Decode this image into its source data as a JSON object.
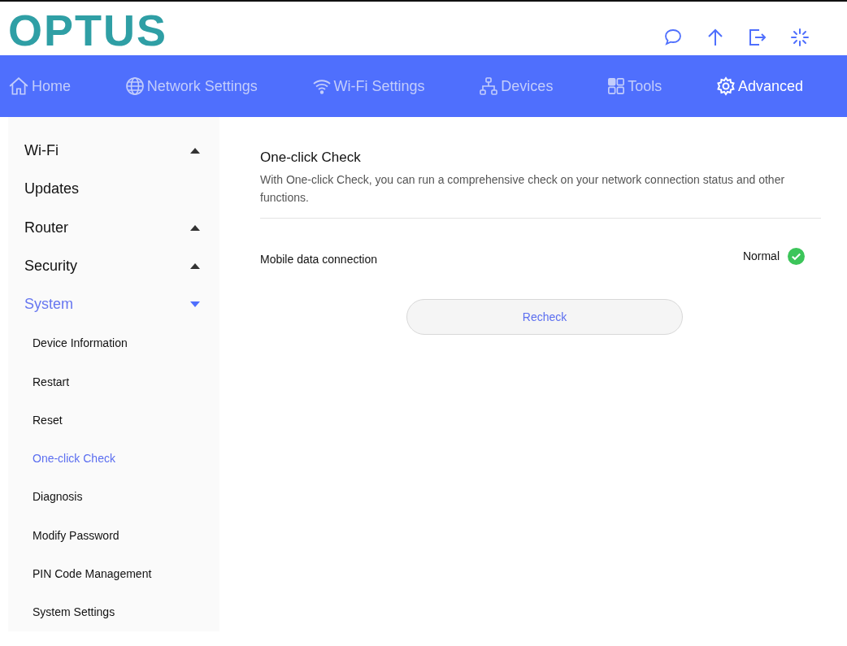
{
  "logo": "OPTUS",
  "nav": [
    {
      "label": "Home",
      "selected": false
    },
    {
      "label": "Network Settings",
      "selected": false
    },
    {
      "label": "Wi-Fi Settings",
      "selected": false
    },
    {
      "label": "Devices",
      "selected": false
    },
    {
      "label": "Tools",
      "selected": false
    },
    {
      "label": "Advanced",
      "selected": true
    }
  ],
  "sidebar": {
    "items": [
      {
        "label": "Wi-Fi",
        "kind": "group",
        "expanded": false,
        "selected": false
      },
      {
        "label": "Updates",
        "kind": "link",
        "selected": false
      },
      {
        "label": "Router",
        "kind": "group",
        "expanded": false,
        "selected": false
      },
      {
        "label": "Security",
        "kind": "group",
        "expanded": false,
        "selected": false
      },
      {
        "label": "System",
        "kind": "group",
        "expanded": true,
        "selected": true,
        "children": [
          {
            "label": "Device Information",
            "selected": false
          },
          {
            "label": "Restart",
            "selected": false
          },
          {
            "label": "Reset",
            "selected": false
          },
          {
            "label": "One-click Check",
            "selected": true
          },
          {
            "label": "Diagnosis",
            "selected": false
          },
          {
            "label": "Modify Password",
            "selected": false
          },
          {
            "label": "PIN Code Management",
            "selected": false
          },
          {
            "label": "System Settings",
            "selected": false
          }
        ]
      }
    ]
  },
  "content": {
    "title": "One-click Check",
    "description": "With One-click Check, you can run a comprehensive check on your network connection status and other functions.",
    "checks": [
      {
        "label": "Mobile data connection",
        "status": "Normal",
        "ok": true
      }
    ],
    "button": "Recheck"
  }
}
